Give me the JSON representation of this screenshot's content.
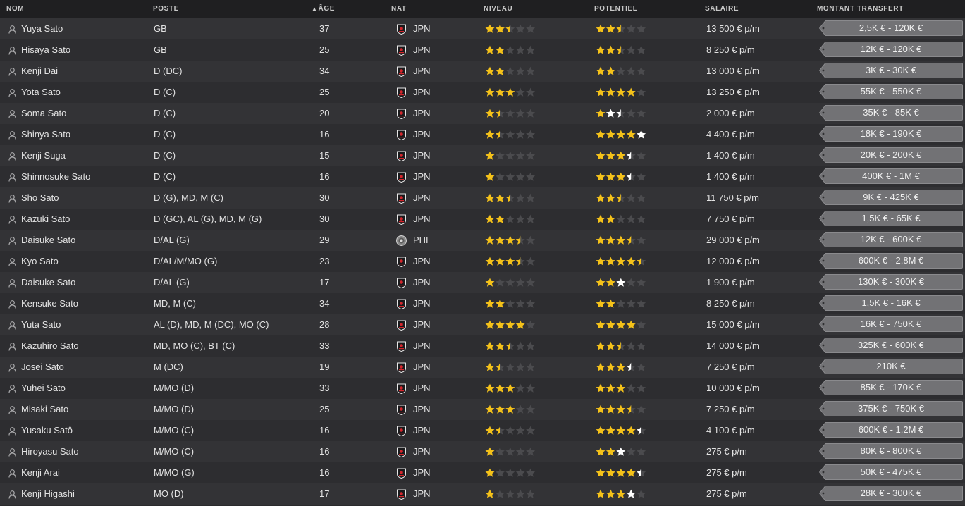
{
  "columns": {
    "nom": "NOM",
    "poste": "POSTE",
    "age": "ÂGE",
    "nat": "NAT",
    "niveau": "NIVEAU",
    "potentiel": "POTENTIEL",
    "salaire": "SALAIRE",
    "transfert": "MONTANT TRANSFERT"
  },
  "colors": {
    "star_gold": "#f5c219",
    "star_empty": "#4b4b4e",
    "star_white": "#ffffff"
  },
  "players": [
    {
      "name": "Yuya Sato",
      "position": "GB",
      "age": "37",
      "nat": "JPN",
      "flag": "jpn",
      "level": 2.5,
      "potential": 2.5,
      "potential_white": 0,
      "salary": "13 500 € p/m",
      "transfer": "2,5K € - 120K €"
    },
    {
      "name": "Hisaya Sato",
      "position": "GB",
      "age": "25",
      "nat": "JPN",
      "flag": "jpn",
      "level": 2,
      "potential": 2.5,
      "potential_white": 0,
      "salary": "8 250 € p/m",
      "transfer": "12K € - 120K €"
    },
    {
      "name": "Kenji Dai",
      "position": "D (DC)",
      "age": "34",
      "nat": "JPN",
      "flag": "jpn",
      "level": 2,
      "potential": 2,
      "potential_white": 0,
      "salary": "13 000 € p/m",
      "transfer": "3K € - 30K €"
    },
    {
      "name": "Yota Sato",
      "position": "D (C)",
      "age": "25",
      "nat": "JPN",
      "flag": "jpn",
      "level": 3,
      "potential": 4,
      "potential_white": 0,
      "salary": "13 250 € p/m",
      "transfer": "55K € - 550K €"
    },
    {
      "name": "Soma Sato",
      "position": "D (C)",
      "age": "20",
      "nat": "JPN",
      "flag": "jpn",
      "level": 1.5,
      "potential": 1,
      "potential_white": 1.5,
      "salary": "2 000 € p/m",
      "transfer": "35K € - 85K €"
    },
    {
      "name": "Shinya Sato",
      "position": "D (C)",
      "age": "16",
      "nat": "JPN",
      "flag": "jpn",
      "level": 1.5,
      "potential": 4,
      "potential_white": 1,
      "salary": "4 400 € p/m",
      "transfer": "18K € - 190K €"
    },
    {
      "name": "Kenji Suga",
      "position": "D (C)",
      "age": "15",
      "nat": "JPN",
      "flag": "jpn",
      "level": 1,
      "potential": 3,
      "potential_white": 0.5,
      "salary": "1 400 € p/m",
      "transfer": "20K € - 200K €"
    },
    {
      "name": "Shinnosuke Sato",
      "position": "D (C)",
      "age": "16",
      "nat": "JPN",
      "flag": "jpn",
      "level": 1,
      "potential": 3,
      "potential_white": 0.5,
      "salary": "1 400 € p/m",
      "transfer": "400K € - 1M €"
    },
    {
      "name": "Sho Sato",
      "position": "D (G), MD, M (C)",
      "age": "30",
      "nat": "JPN",
      "flag": "jpn",
      "level": 2.5,
      "potential": 2.5,
      "potential_white": 0,
      "salary": "11 750 € p/m",
      "transfer": "9K € - 425K €"
    },
    {
      "name": "Kazuki Sato",
      "position": "D (GC), AL (G), MD, M (G)",
      "age": "30",
      "nat": "JPN",
      "flag": "jpn",
      "level": 2,
      "potential": 2,
      "potential_white": 0,
      "salary": "7 750 € p/m",
      "transfer": "1,5K € - 65K €"
    },
    {
      "name": "Daisuke Sato",
      "position": "D/AL (G)",
      "age": "29",
      "nat": "PHI",
      "flag": "phi",
      "level": 3.5,
      "potential": 3.5,
      "potential_white": 0,
      "salary": "29 000 € p/m",
      "transfer": "12K € - 600K €"
    },
    {
      "name": "Kyo Sato",
      "position": "D/AL/M/MO (G)",
      "age": "23",
      "nat": "JPN",
      "flag": "jpn",
      "level": 3.5,
      "potential": 4.5,
      "potential_white": 0,
      "salary": "12 000 € p/m",
      "transfer": "600K € - 2,8M €"
    },
    {
      "name": "Daisuke Sato",
      "position": "D/AL (G)",
      "age": "17",
      "nat": "JPN",
      "flag": "jpn",
      "level": 1,
      "potential": 2,
      "potential_white": 1,
      "salary": "1 900 € p/m",
      "transfer": "130K € - 300K €"
    },
    {
      "name": "Kensuke Sato",
      "position": "MD, M (C)",
      "age": "34",
      "nat": "JPN",
      "flag": "jpn",
      "level": 2,
      "potential": 2,
      "potential_white": 0,
      "salary": "8 250 € p/m",
      "transfer": "1,5K € - 16K €"
    },
    {
      "name": "Yuta Sato",
      "position": "AL (D), MD, M (DC), MO (C)",
      "age": "28",
      "nat": "JPN",
      "flag": "jpn",
      "level": 4,
      "potential": 4,
      "potential_white": 0,
      "salary": "15 000 € p/m",
      "transfer": "16K € - 750K €"
    },
    {
      "name": "Kazuhiro Sato",
      "position": "MD, MO (C), BT (C)",
      "age": "33",
      "nat": "JPN",
      "flag": "jpn",
      "level": 2.5,
      "potential": 2.5,
      "potential_white": 0,
      "salary": "14 000 € p/m",
      "transfer": "325K € - 600K €"
    },
    {
      "name": "Josei Sato",
      "position": "M (DC)",
      "age": "19",
      "nat": "JPN",
      "flag": "jpn",
      "level": 1.5,
      "potential": 3,
      "potential_white": 0.5,
      "salary": "7 250 € p/m",
      "transfer": "210K €"
    },
    {
      "name": "Yuhei Sato",
      "position": "M/MO (D)",
      "age": "33",
      "nat": "JPN",
      "flag": "jpn",
      "level": 3,
      "potential": 3,
      "potential_white": 0,
      "salary": "10 000 € p/m",
      "transfer": "85K € - 170K €"
    },
    {
      "name": "Misaki Sato",
      "position": "M/MO (D)",
      "age": "25",
      "nat": "JPN",
      "flag": "jpn",
      "level": 3,
      "potential": 3.5,
      "potential_white": 0,
      "salary": "7 250 € p/m",
      "transfer": "375K € - 750K €"
    },
    {
      "name": "Yusaku Satô",
      "position": "M/MO (C)",
      "age": "16",
      "nat": "JPN",
      "flag": "jpn",
      "level": 1.5,
      "potential": 4,
      "potential_white": 0.5,
      "salary": "4 100 € p/m",
      "transfer": "600K € - 1,2M €"
    },
    {
      "name": "Hiroyasu Sato",
      "position": "M/MO (C)",
      "age": "16",
      "nat": "JPN",
      "flag": "jpn",
      "level": 1,
      "potential": 2,
      "potential_white": 1,
      "salary": "275 € p/m",
      "transfer": "80K € - 800K €"
    },
    {
      "name": "Kenji Arai",
      "position": "M/MO (G)",
      "age": "16",
      "nat": "JPN",
      "flag": "jpn",
      "level": 1,
      "potential": 4,
      "potential_white": 0.5,
      "salary": "275 € p/m",
      "transfer": "50K € - 475K €"
    },
    {
      "name": "Kenji Higashi",
      "position": "MO (D)",
      "age": "17",
      "nat": "JPN",
      "flag": "jpn",
      "level": 1,
      "potential": 3,
      "potential_white": 1,
      "salary": "275 € p/m",
      "transfer": "28K € - 300K €"
    }
  ]
}
